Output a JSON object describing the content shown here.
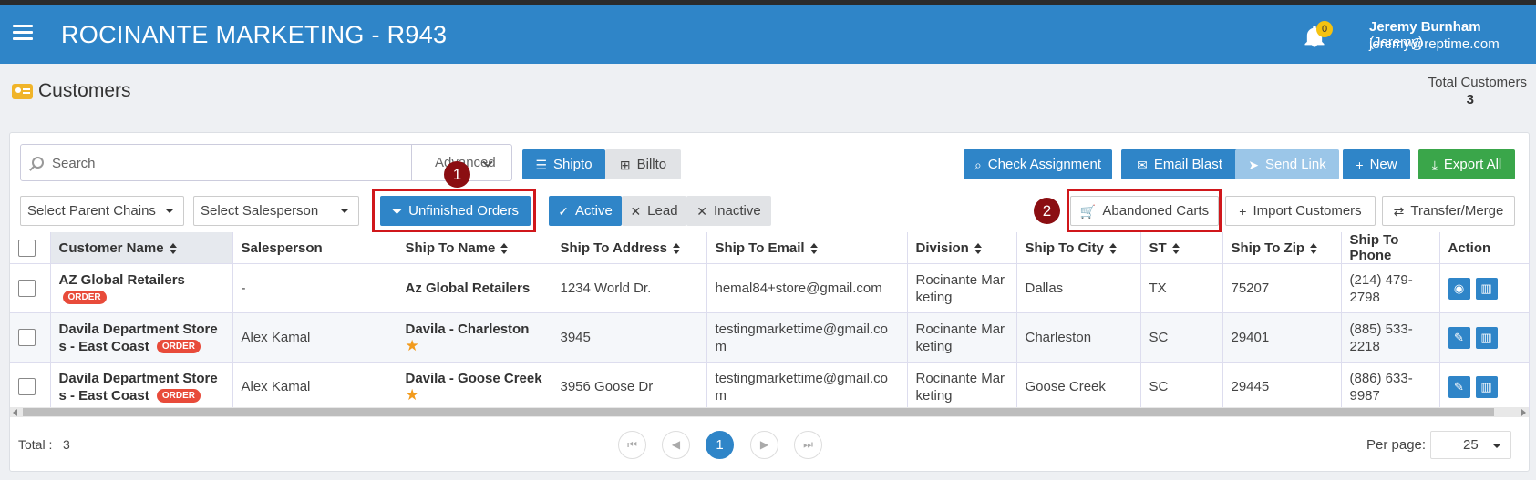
{
  "header": {
    "title": "ROCINANTE MARKETING - R943",
    "notification_count": "0",
    "user_name": "Jeremy Burnham",
    "user_nick": "(Jeremy)",
    "user_email": "jeremy@reptime.com"
  },
  "page": {
    "title": "Customers",
    "total_label": "Total Customers",
    "total_value": "3"
  },
  "toolbar": {
    "search_placeholder": "Search",
    "advanced_label": "Advanced",
    "shipto_label": "Shipto",
    "billto_label": "Billto",
    "check_assignment_label": "Check Assignment",
    "email_blast_label": "Email Blast",
    "send_link_label": "Send Link",
    "new_label": "New",
    "export_all_label": "Export All"
  },
  "filters": {
    "parent_chains_label": "Select Parent Chains",
    "salesperson_label": "Select Salesperson",
    "unfinished_orders_label": "Unfinished Orders",
    "active_label": "Active",
    "lead_label": "Lead",
    "inactive_label": "Inactive",
    "abandoned_carts_label": "Abandoned Carts",
    "import_customers_label": "Import Customers",
    "transfer_merge_label": "Transfer/Merge"
  },
  "annotations": {
    "marker_1": "1",
    "marker_2": "2"
  },
  "table": {
    "columns": [
      "Customer Name",
      "Salesperson",
      "Ship To Name",
      "Ship To Address",
      "Ship To Email",
      "Division",
      "Ship To City",
      "ST",
      "Ship To Zip",
      "Ship To Phone",
      "Action"
    ],
    "rows": [
      {
        "customer_name": "AZ Global Retailers",
        "badge": "ORDER",
        "salesperson": "-",
        "ship_to_name": "Az Global Retailers",
        "address": "1234 World Dr.",
        "email": "hemal84+store@gmail.com",
        "division": "Rocinante Mar keting",
        "city": "Dallas",
        "st": "TX",
        "zip": "75207",
        "phone": "(214) 479-2798"
      },
      {
        "customer_name": "Davila Department Store s - East Coast",
        "badge": "ORDER",
        "salesperson": "Alex Kamal",
        "ship_to_name": "Davila - Charleston",
        "address": "3945",
        "email": "testingmarkettime@gmail.co m",
        "division": "Rocinante Mar keting",
        "city": "Charleston",
        "st": "SC",
        "zip": "29401",
        "phone": "(885) 533-2218"
      },
      {
        "customer_name": "Davila Department Store s - East Coast",
        "badge": "ORDER",
        "salesperson": "Alex Kamal",
        "ship_to_name": "Davila - Goose Creek",
        "address": "3956 Goose Dr",
        "email": "testingmarkettime@gmail.co m",
        "division": "Rocinante Mar keting",
        "city": "Goose Creek",
        "st": "SC",
        "zip": "29445",
        "phone": "(886) 633-9987"
      }
    ]
  },
  "footer": {
    "total_label": "Total :",
    "total_value": "3",
    "current_page": "1",
    "per_page_label": "Per page:",
    "per_page_value": "25"
  },
  "colors": {
    "header_bg": "#2f85c8",
    "primary": "#2f85c8",
    "success": "#3aa64a",
    "highlight": "#d0171b",
    "order_badge": "#e84b3a"
  }
}
